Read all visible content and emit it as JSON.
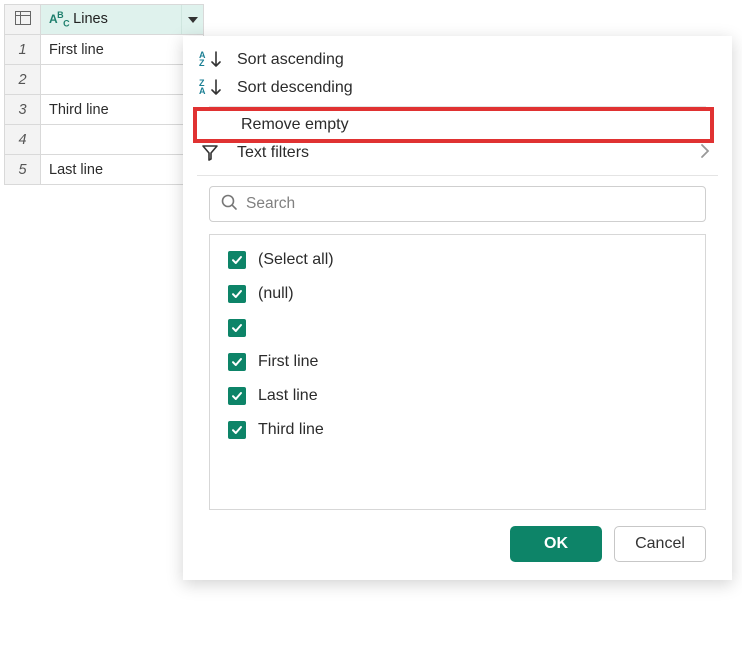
{
  "column": {
    "type_label": "ABC",
    "title": "Lines"
  },
  "rows": [
    {
      "num": "1",
      "value": "First line"
    },
    {
      "num": "2",
      "value": ""
    },
    {
      "num": "3",
      "value": "Third line"
    },
    {
      "num": "4",
      "value": ""
    },
    {
      "num": "5",
      "value": "Last line"
    }
  ],
  "menu": {
    "sort_asc": "Sort ascending",
    "sort_desc": "Sort descending",
    "remove_empty": "Remove empty",
    "text_filters": "Text filters"
  },
  "search": {
    "placeholder": "Search"
  },
  "filter_values": [
    "(Select all)",
    "(null)",
    "",
    "First line",
    "Last line",
    "Third line"
  ],
  "buttons": {
    "ok": "OK",
    "cancel": "Cancel"
  }
}
